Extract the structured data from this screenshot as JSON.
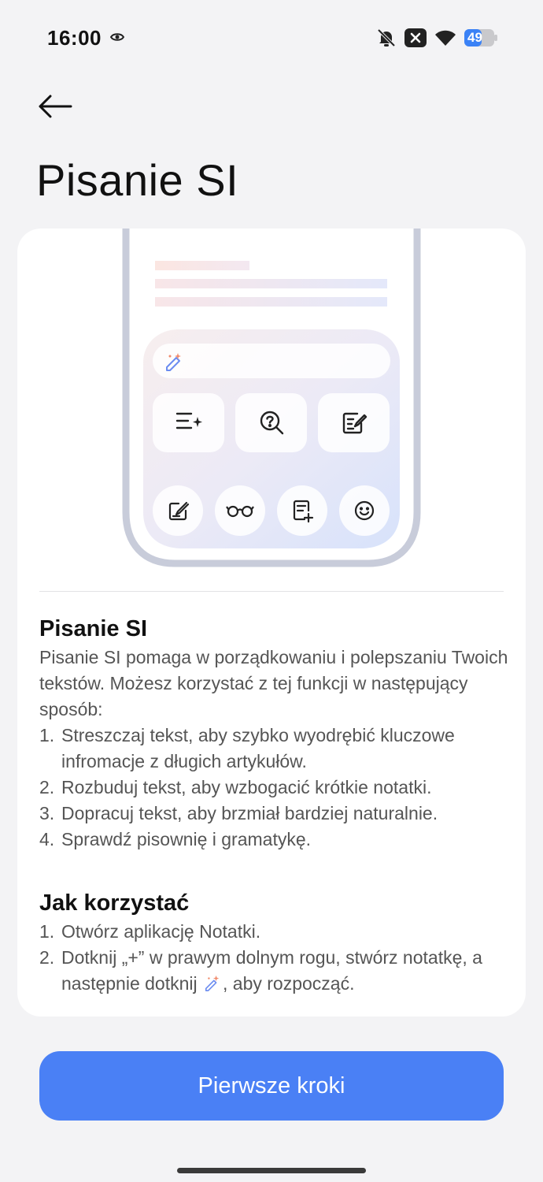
{
  "status_bar": {
    "time": "16:00",
    "battery_level": "49",
    "icons": [
      "eye-icon",
      "bell-off-icon",
      "close-badge-icon",
      "wifi-icon",
      "battery-icon"
    ]
  },
  "header": {
    "back_icon": "arrow-left-icon",
    "title": "Pisanie SI"
  },
  "illustration": {
    "toolbar_icons": [
      "magic-pen-icon",
      "sparkle-list-icon",
      "question-search-icon",
      "edit-note-icon"
    ],
    "bottom_icons": [
      "pen-square-icon",
      "glasses-icon",
      "note-add-icon",
      "smile-icon"
    ]
  },
  "about": {
    "heading": "Pisanie SI",
    "intro": "Pisanie SI pomaga w porządkowaniu i polepszaniu Twoich tekstów. Możesz korzystać z tej funkcji w następujący sposób:",
    "items": [
      {
        "num": "1.",
        "text": "Streszczaj tekst, aby szybko wyodrębić kluczowe infromacje z długich artykułów."
      },
      {
        "num": "2.",
        "text": "Rozbuduj tekst, aby wzbogacić krótkie notatki."
      },
      {
        "num": "3.",
        "text": "Dopracuj tekst, aby brzmiał bardziej naturalnie."
      },
      {
        "num": "4.",
        "text": "Sprawdź pisownię i gramatykę."
      }
    ]
  },
  "how_to": {
    "heading": "Jak korzystać",
    "items": [
      {
        "num": "1.",
        "text": "Otwórz aplikację Notatki."
      },
      {
        "num": "2.",
        "text_before": "Dotknij „+” w prawym dolnym rogu, stwórz notatkę, a następnie dotknij ",
        "text_after": ", aby rozpocząć."
      }
    ]
  },
  "primary_button": {
    "label": "Pierwsze kroki",
    "color": "#4a80f5"
  }
}
